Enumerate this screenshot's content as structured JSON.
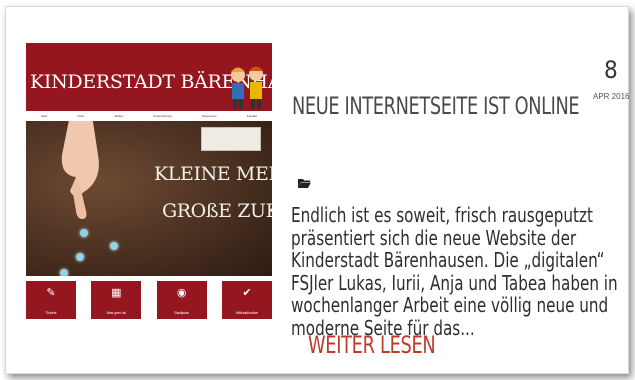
{
  "post": {
    "date_day": "8",
    "date_month_year": "APR 2016",
    "title": "NEUE INTERNETSEITE IST ONLINE",
    "excerpt": "Endlich ist es soweit, frisch rausgeputzt präsentiert sich die neue Website der Kinderstadt Bärenhausen. Die „digitalen“ FSJler Lukas, Iurii, Anja und Tabea haben in wochenlanger Arbeit eine völlig neue und moderne Seite für das...",
    "read_more": "WEITER LESEN"
  },
  "thumbnail": {
    "site_title": "KINDERSTADT BÄRENHAUSEN",
    "nav_items": [
      "Start",
      "Infos",
      "Ablauf",
      "Unterstützung",
      "Sponsoren",
      "Kontakt"
    ],
    "hero_line1": "KLEINE MENSCHEN",
    "hero_line2": "GROßE ZUKUNFT",
    "buttons": [
      {
        "icon": "ticket-icon",
        "glyph": "✎",
        "label": "Tickets"
      },
      {
        "icon": "calendar-icon",
        "glyph": "▦",
        "label": "Was geht ab"
      },
      {
        "icon": "map-icon",
        "glyph": "◉",
        "label": "Stadtplan"
      },
      {
        "icon": "check-icon",
        "glyph": "✔",
        "label": "Mitfunktionäre"
      }
    ]
  },
  "colors": {
    "brand_red": "#95161f",
    "link_red": "#c0392b",
    "text": "#2e2e2e"
  }
}
